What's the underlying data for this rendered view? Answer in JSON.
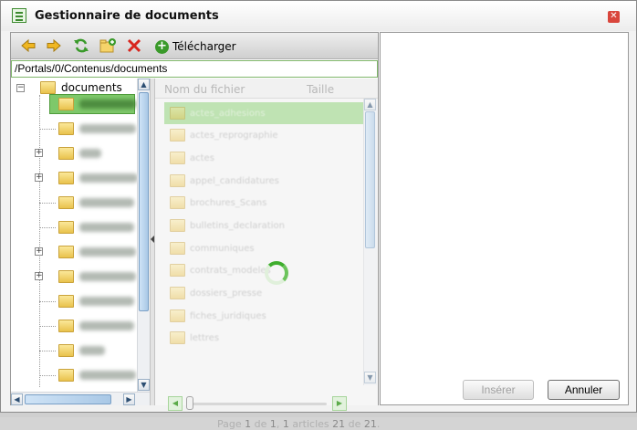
{
  "dialog": {
    "title": "Gestionnaire de documents"
  },
  "toolbar": {
    "back_icon": "arrow-left-icon",
    "forward_icon": "arrow-right-icon",
    "refresh_icon": "refresh-icon",
    "new_folder_icon": "new-folder-icon",
    "delete_icon": "delete-icon",
    "upload_label": "Télécharger"
  },
  "path": "/Portals/0/Contenus/documents",
  "tree": {
    "root_label": "documents"
  },
  "grid": {
    "col_name": "Nom du fichier",
    "col_size": "Taille",
    "rows": [
      "actes_adhesions",
      "actes_reprographie",
      "actes",
      "appel_candidatures",
      "brochures_Scans",
      "bulletins_declaration",
      "communiques",
      "contrats_modeles",
      "dossiers_presse",
      "fiches_juridiques",
      "lettres"
    ]
  },
  "pager": {
    "page_label": "Page",
    "page_current": "1",
    "page_of": "de",
    "page_total": "1",
    "items_label": "articles",
    "items_from": "1",
    "items_to": "21",
    "items_total": "21"
  },
  "buttons": {
    "insert": "Insérer",
    "cancel": "Annuler"
  },
  "colors": {
    "accent_green": "#3fae2e",
    "selection_green": "#7ec86a",
    "close_red": "#d9463c"
  }
}
